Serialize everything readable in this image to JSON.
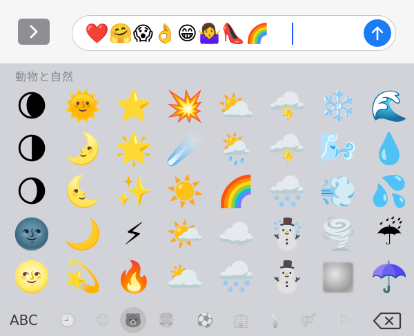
{
  "input_bar": {
    "app_button_icon": "chevron-right-icon",
    "field_text": "❤️🤗😱👌😁🤷‍♀️👠🌈",
    "send_icon": "arrow-up-icon",
    "send_color": "#1b7cf5"
  },
  "keyboard": {
    "category_title": "動物と自然",
    "rows": [
      [
        "🌘",
        "🌞",
        "⭐",
        "💥",
        "⛅",
        "🌩️",
        "❄️",
        "🌊"
      ],
      [
        "🌗",
        "🌛",
        "🌟",
        "☄️",
        "🌦️",
        "🌩️",
        "🌬️",
        "💧"
      ],
      [
        "🌖",
        "🌜",
        "✨",
        "☀️",
        "🌈",
        "🌨️",
        "💨",
        "💦"
      ],
      [
        "🌚",
        "🌙",
        "⚡",
        "🌤️",
        "☁️",
        "☃️",
        "🌪️",
        "☔"
      ],
      [
        "🌝",
        "💫",
        "🔥",
        "🌥️",
        "🌨️",
        "⛄",
        "fog",
        "☂️"
      ]
    ]
  },
  "bottom_bar": {
    "abc_label": "ABC",
    "categories": [
      {
        "icon": "clock-icon",
        "glyph": "🕘"
      },
      {
        "icon": "smiley-icon",
        "glyph": "☺"
      },
      {
        "icon": "bear-icon",
        "glyph": "🐻"
      },
      {
        "icon": "food-icon",
        "glyph": "🍔"
      },
      {
        "icon": "soccer-icon",
        "glyph": "⚽"
      },
      {
        "icon": "building-icon",
        "glyph": "🏢"
      },
      {
        "icon": "lightbulb-icon",
        "glyph": "💡"
      },
      {
        "icon": "symbols-icon",
        "glyph": "⚤"
      },
      {
        "icon": "flag-icon",
        "glyph": "⚐"
      }
    ],
    "delete_icon": "backspace-icon"
  }
}
